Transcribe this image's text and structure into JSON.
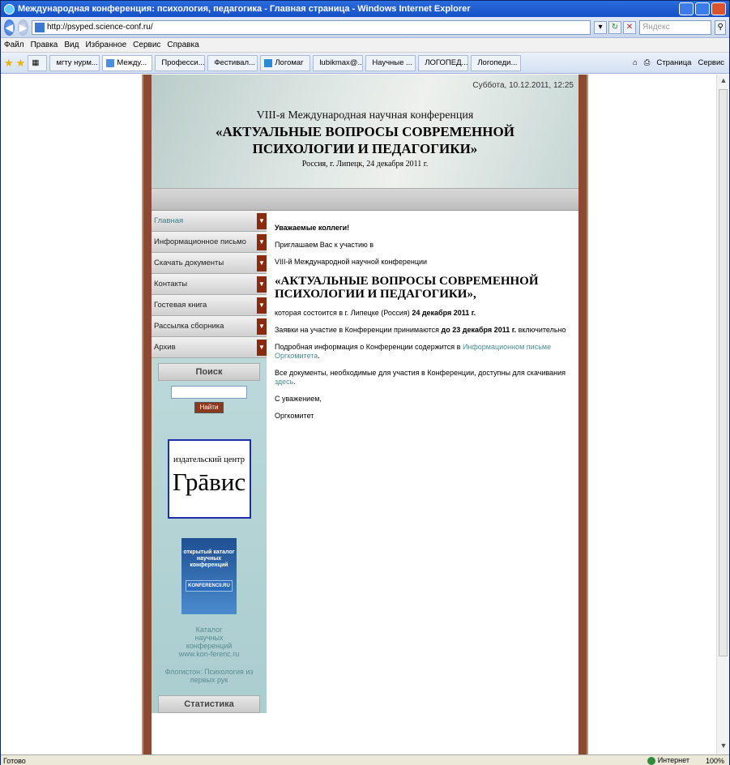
{
  "window": {
    "title": "Международная конференция: психология, педагогика - Главная страница - Windows Internet Explorer"
  },
  "address": {
    "url": "http://psyped.science-conf.ru/",
    "search_placeholder": "Яндекс"
  },
  "menu": [
    "Файл",
    "Правка",
    "Вид",
    "Избранное",
    "Сервис",
    "Справка"
  ],
  "tabs": [
    "мгту нурм...",
    "Между...",
    "Професси...",
    "Фестивал...",
    "Логомаг",
    "lubikmax@...",
    "Научные ...",
    "ЛОГОПЕД...",
    "Логопеди..."
  ],
  "tab_tools": {
    "page": "Страница",
    "service": "Сервис"
  },
  "header": {
    "date": "Суббота, 10.12.2011, 12:25",
    "line1": "VIII-я Международная научная конференция",
    "line2a": "«АКТУАЛЬНЫЕ ВОПРОСЫ СОВРЕМЕННОЙ",
    "line2b": "ПСИХОЛОГИИ И ПЕДАГОГИКИ»",
    "place": "Россия, г. Липецк, 24 декабря 2011 г."
  },
  "nav": [
    "Главная",
    "Информационное письмо",
    "Скачать документы",
    "Контакты",
    "Гостевая книга",
    "Рассылка сборника",
    "Архив"
  ],
  "sidebar": {
    "search_title": "Поиск",
    "search_button": "Найти",
    "banner1_line1": "издательский центр",
    "banner1_line2": "Грāвис",
    "banner2_text": "открытый каталог научных конференций",
    "banner2_site": "KONFERENCII.RU",
    "catalog_line1": "Каталог",
    "catalog_line2": "научных",
    "catalog_line3": "конференций",
    "catalog_line4": "www.kon-ferenc.ru",
    "flogiston": "Флогистон: Психология из первых рук",
    "stats_title": "Статистика"
  },
  "main": {
    "greeting": "Уважаемые коллеги!",
    "invite": "Приглашаем Вас к участию в",
    "conf": "VIII-й Международной научной конференции",
    "title1": "«АКТУАЛЬНЫЕ ВОПРОСЫ СОВРЕМЕННОЙ",
    "title2": "ПСИХОЛОГИИ И ПЕДАГОГИКИ»,",
    "where_prefix": "которая состоится в г. Липецке (Россия) ",
    "where_date": "24 декабря 2011 г.",
    "apps_prefix": "Заявки на участие в Конференции принимаются ",
    "apps_date": "до 23 декабря 2011 г.",
    "apps_suffix": " включительно",
    "info_prefix": "Подробная информация о Конференции содержится в ",
    "info_link": "Информационном письме Оргкомитета",
    "info_suffix": ".",
    "docs_prefix": "Все документы, необходимые для участия в Конференции, доступны для скачивания ",
    "docs_link": "здесь",
    "docs_suffix": ".",
    "regards": "С уважением,",
    "sign": "Оргкомитет"
  },
  "status": {
    "left": "Готово",
    "zone": "Интернет",
    "zoom": "100%"
  }
}
